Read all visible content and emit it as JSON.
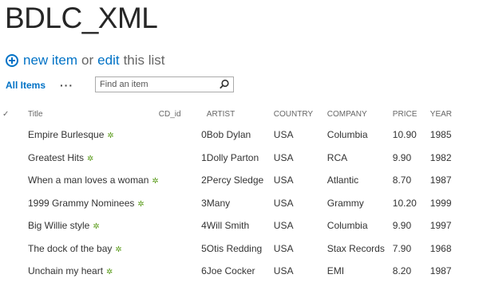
{
  "page": {
    "title": "BDLC_XML"
  },
  "command_bar": {
    "new_item_label": "new item",
    "or_text": "or",
    "edit_label": "edit",
    "this_list_text": "this list"
  },
  "view": {
    "all_items_label": "All Items",
    "more_label": "···",
    "search_placeholder": "Find an item"
  },
  "table": {
    "headers": {
      "check": "✓",
      "title": "Title",
      "cd_id": "CD_id",
      "artist": "ARTIST",
      "country": "COUNTRY",
      "company": "COMPANY",
      "price": "PRICE",
      "year": "YEAR"
    },
    "rows": [
      {
        "title": "Empire Burlesque",
        "cd_id": "0",
        "artist": "Bob Dylan",
        "country": "USA",
        "company": "Columbia",
        "price": "10.90",
        "year": "1985"
      },
      {
        "title": "Greatest Hits",
        "cd_id": "1",
        "artist": "Dolly Parton",
        "country": "USA",
        "company": "RCA",
        "price": "9.90",
        "year": "1982"
      },
      {
        "title": "When a man loves a woman",
        "cd_id": "2",
        "artist": "Percy Sledge",
        "country": "USA",
        "company": "Atlantic",
        "price": "8.70",
        "year": "1987"
      },
      {
        "title": "1999 Grammy Nominees",
        "cd_id": "3",
        "artist": "Many",
        "country": "USA",
        "company": "Grammy",
        "price": "10.20",
        "year": "1999"
      },
      {
        "title": "Big Willie style",
        "cd_id": "4",
        "artist": "Will Smith",
        "country": "USA",
        "company": "Columbia",
        "price": "9.90",
        "year": "1997"
      },
      {
        "title": "The dock of the bay",
        "cd_id": "5",
        "artist": "Otis Redding",
        "country": "USA",
        "company": "Stax Records",
        "price": "7.90",
        "year": "1968"
      },
      {
        "title": "Unchain my heart",
        "cd_id": "6",
        "artist": "Joe Cocker",
        "country": "USA",
        "company": "EMI",
        "price": "8.20",
        "year": "1987"
      }
    ],
    "new_icon_glyph": "✲"
  },
  "colors": {
    "accent": "#0072c6",
    "new_icon": "#5a9b1a"
  },
  "icons": {
    "add": "plus-circle-icon",
    "search": "search-icon",
    "new": "new-item-icon"
  }
}
